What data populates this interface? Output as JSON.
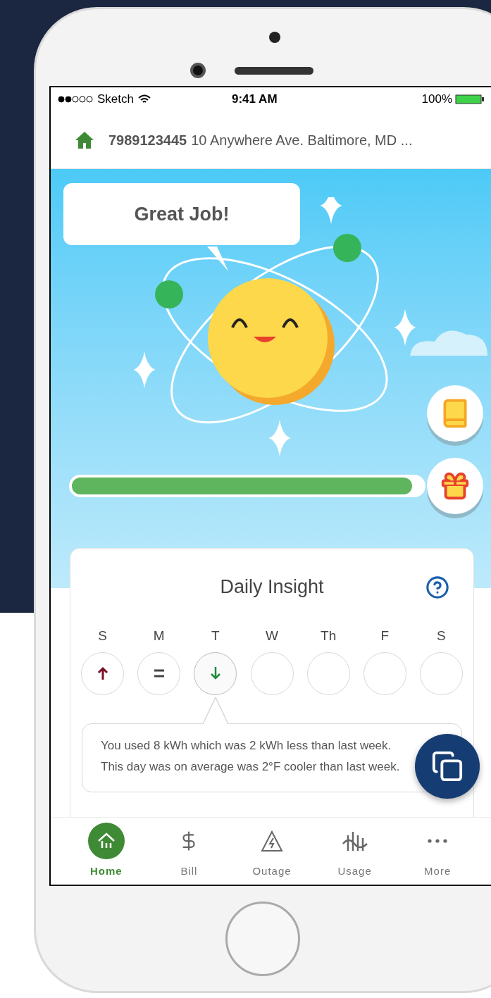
{
  "status_bar": {
    "carrier": "Sketch",
    "time": "9:41 AM",
    "battery": "100%"
  },
  "account": {
    "number": "7989123445",
    "address": "10 Anywhere Ave. Baltimore, MD ..."
  },
  "hero": {
    "message": "Great Job!",
    "progress": {
      "level": 0.97
    }
  },
  "insight": {
    "title": "Daily Insight",
    "detail": "You used 8 kWh which was 2 kWh less than last week. This day was on average was 2°F cooler than last week.",
    "days": [
      {
        "label": "S",
        "kind": "up",
        "selected": false
      },
      {
        "label": "M",
        "kind": "same",
        "selected": false
      },
      {
        "label": "T",
        "kind": "down",
        "selected": true
      },
      {
        "label": "W",
        "kind": "empty",
        "selected": false
      },
      {
        "label": "Th",
        "kind": "empty",
        "selected": false
      },
      {
        "label": "F",
        "kind": "empty",
        "selected": false
      },
      {
        "label": "S",
        "kind": "empty",
        "selected": false
      }
    ]
  },
  "nav": [
    {
      "label": "Home",
      "kind": "home",
      "selected": true
    },
    {
      "label": "Bill",
      "kind": "bill",
      "selected": false
    },
    {
      "label": "Outage",
      "kind": "outage",
      "selected": false
    },
    {
      "label": "Usage",
      "kind": "usage",
      "selected": false
    },
    {
      "label": "More",
      "kind": "more",
      "selected": false
    }
  ]
}
